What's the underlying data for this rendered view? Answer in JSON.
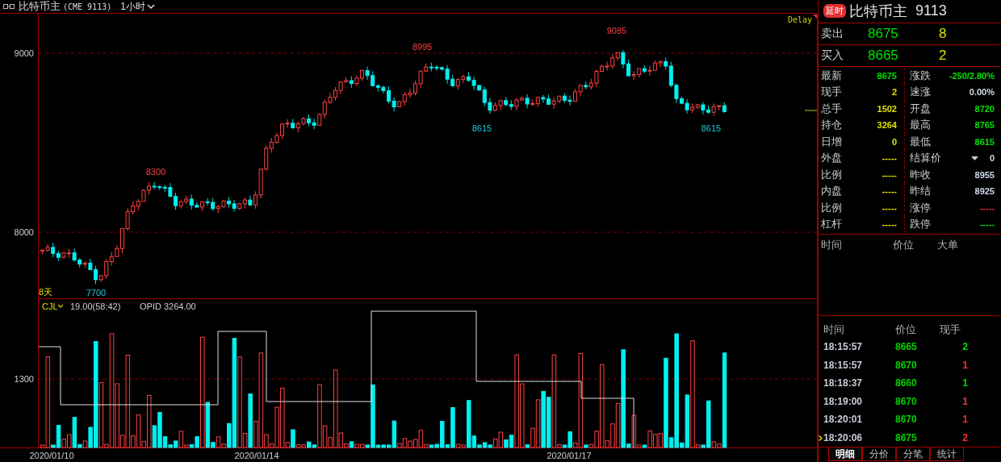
{
  "header": {
    "name": "比特币主",
    "contract": "(CME 9113)",
    "period": "1小时"
  },
  "chart": {
    "delay_label": "Delay",
    "y_labels": [
      "9000",
      "8000"
    ],
    "days_label": "8天",
    "annotations": [
      {
        "text": "8300",
        "kind": "high"
      },
      {
        "text": "8995",
        "kind": "high"
      },
      {
        "text": "9085",
        "kind": "high"
      },
      {
        "text": "8615",
        "kind": "low"
      },
      {
        "text": "8615",
        "kind": "low"
      },
      {
        "text": "7700",
        "kind": "low"
      }
    ]
  },
  "volume": {
    "indicator": "CJL",
    "reading": "19.00(58:42)",
    "opid": "OPID 3264.00",
    "y_label": "1300"
  },
  "dates": [
    "2020/01/10",
    "2020/01/14",
    "2020/01/17"
  ],
  "quote": {
    "badge": "延时",
    "name": "比特币主",
    "code": "9113",
    "sell": {
      "label": "卖出",
      "price": "8675",
      "qty": "8"
    },
    "buy": {
      "label": "买入",
      "price": "8665",
      "qty": "2"
    }
  },
  "stats": [
    {
      "left": {
        "label": "最新",
        "value": "8675",
        "color": "#00e000",
        "dropdown": false
      },
      "right": {
        "label": "涨跌",
        "value": "-250/2.80%",
        "color": "#00e000",
        "dropdown": false
      }
    },
    {
      "left": {
        "label": "现手",
        "value": "2",
        "color": "#e0e000",
        "dropdown": false
      },
      "right": {
        "label": "速涨",
        "value": "0.00%",
        "color": "#d0d8e8",
        "dropdown": false
      }
    },
    {
      "left": {
        "label": "总手",
        "value": "1502",
        "color": "#e0e000",
        "dropdown": false
      },
      "right": {
        "label": "开盘",
        "value": "8720",
        "color": "#00e000",
        "dropdown": false
      }
    },
    {
      "left": {
        "label": "持仓",
        "value": "3264",
        "color": "#e0e000",
        "dropdown": false
      },
      "right": {
        "label": "最高",
        "value": "8765",
        "color": "#00e000",
        "dropdown": false
      }
    },
    {
      "left": {
        "label": "日增",
        "value": "0",
        "color": "#e0e000",
        "dropdown": false
      },
      "right": {
        "label": "最低",
        "value": "8615",
        "color": "#00e000",
        "dropdown": false
      }
    },
    {
      "left": {
        "label": "外盘",
        "value": "-----",
        "color": "#e0e000",
        "dropdown": false
      },
      "right": {
        "label": "结算价",
        "value": "0",
        "color": "#d0d8e8",
        "dropdown": true
      }
    },
    {
      "left": {
        "label": "比例",
        "value": "-----",
        "color": "#e0e000",
        "dropdown": false
      },
      "right": {
        "label": "昨收",
        "value": "8955",
        "color": "#d0d8e8",
        "dropdown": false
      }
    },
    {
      "left": {
        "label": "内盘",
        "value": "-----",
        "color": "#e0e000",
        "dropdown": false
      },
      "right": {
        "label": "昨结",
        "value": "8925",
        "color": "#d0d8e8",
        "dropdown": false
      }
    },
    {
      "left": {
        "label": "比例",
        "value": "-----",
        "color": "#e0e000",
        "dropdown": false
      },
      "right": {
        "label": "涨停",
        "value": "-----",
        "color": "#e03030",
        "dropdown": false
      }
    },
    {
      "left": {
        "label": "杠杆",
        "value": "-----",
        "color": "#e0e000",
        "dropdown": false
      },
      "right": {
        "label": "跌停",
        "value": "-----",
        "color": "#00e000",
        "dropdown": false
      }
    }
  ],
  "big_orders": {
    "columns": [
      "时间",
      "价位",
      "大单"
    ]
  },
  "ticks": {
    "columns": [
      "时间",
      "价位",
      "现手"
    ],
    "rows": [
      {
        "time": "18:15:57",
        "price": "8665",
        "qty": "2",
        "color": "#00e000",
        "selected": false
      },
      {
        "time": "18:15:57",
        "price": "8670",
        "qty": "1",
        "color": "#ff3030",
        "selected": false
      },
      {
        "time": "18:18:37",
        "price": "8660",
        "qty": "1",
        "color": "#00e000",
        "selected": false
      },
      {
        "time": "18:19:00",
        "price": "8670",
        "qty": "1",
        "color": "#ff3030",
        "selected": false
      },
      {
        "time": "18:20:01",
        "price": "8670",
        "qty": "1",
        "color": "#ff3030",
        "selected": false
      },
      {
        "time": "18:20:06",
        "price": "8675",
        "qty": "2",
        "color": "#ff3030",
        "selected": true
      }
    ]
  },
  "tabs": [
    {
      "label": "明细",
      "selected": true
    },
    {
      "label": "分价",
      "selected": false
    },
    {
      "label": "分笔",
      "selected": false
    },
    {
      "label": "统计",
      "selected": false
    }
  ]
}
